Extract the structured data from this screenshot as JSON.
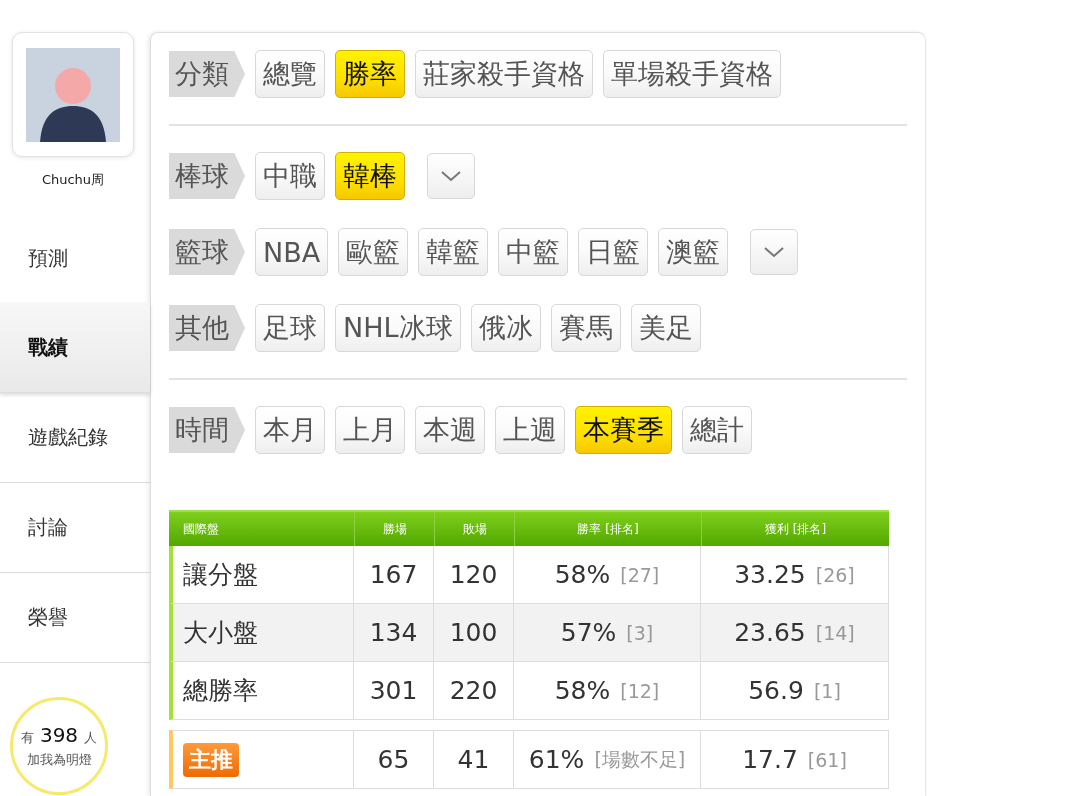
{
  "profile": {
    "name": "Chuchu周"
  },
  "sidebar": {
    "items": [
      {
        "label": "預測",
        "selected": false
      },
      {
        "label": "戰績",
        "selected": true
      },
      {
        "label": "遊戲紀錄",
        "selected": false
      },
      {
        "label": "討論",
        "selected": false
      },
      {
        "label": "榮譽",
        "selected": false
      }
    ]
  },
  "fans": {
    "prefix": "有",
    "count": "398",
    "suffix": "人",
    "caption": "加我為明燈"
  },
  "filter_sections": [
    {
      "rows": [
        {
          "label": "分類",
          "dropdown": false,
          "options": [
            {
              "label": "總覽",
              "selected": false
            },
            {
              "label": "勝率",
              "selected": true
            },
            {
              "label": "莊家殺手資格",
              "selected": false
            },
            {
              "label": "單場殺手資格",
              "selected": false
            }
          ]
        }
      ]
    },
    {
      "rows": [
        {
          "label": "棒球",
          "dropdown": true,
          "options": [
            {
              "label": "中職",
              "selected": false
            },
            {
              "label": "韓棒",
              "selected": true
            }
          ]
        },
        {
          "label": "籃球",
          "dropdown": true,
          "options": [
            {
              "label": "NBA",
              "selected": false
            },
            {
              "label": "歐籃",
              "selected": false
            },
            {
              "label": "韓籃",
              "selected": false
            },
            {
              "label": "中籃",
              "selected": false
            },
            {
              "label": "日籃",
              "selected": false
            },
            {
              "label": "澳籃",
              "selected": false
            }
          ]
        },
        {
          "label": "其他",
          "dropdown": false,
          "options": [
            {
              "label": "足球",
              "selected": false
            },
            {
              "label": "NHL冰球",
              "selected": false
            },
            {
              "label": "俄冰",
              "selected": false
            },
            {
              "label": "賽馬",
              "selected": false
            },
            {
              "label": "美足",
              "selected": false
            }
          ]
        }
      ]
    },
    {
      "rows": [
        {
          "label": "時間",
          "dropdown": false,
          "options": [
            {
              "label": "本月",
              "selected": false
            },
            {
              "label": "上月",
              "selected": false
            },
            {
              "label": "本週",
              "selected": false
            },
            {
              "label": "上週",
              "selected": false
            },
            {
              "label": "本賽季",
              "selected": true
            },
            {
              "label": "總計",
              "selected": false
            }
          ]
        }
      ]
    }
  ],
  "table": {
    "columns": [
      "國際盤",
      "勝場",
      "敗場",
      "勝率 [排名]",
      "獲利 [排名]"
    ],
    "rows": [
      {
        "kind": "normal",
        "name": "讓分盤",
        "wins": "167",
        "losses": "120",
        "rate": "58%",
        "rate_rank": "[27]",
        "profit": "33.25",
        "profit_rank": "[26]"
      },
      {
        "kind": "normal",
        "name": "大小盤",
        "wins": "134",
        "losses": "100",
        "rate": "57%",
        "rate_rank": "[3]",
        "profit": "23.65",
        "profit_rank": "[14]"
      },
      {
        "kind": "normal",
        "name": "總勝率",
        "wins": "301",
        "losses": "220",
        "rate": "58%",
        "rate_rank": "[12]",
        "profit": "56.9",
        "profit_rank": "[1]"
      },
      {
        "kind": "featured",
        "name": "主推",
        "wins": "65",
        "losses": "41",
        "rate": "61%",
        "rate_rank": "[場數不足]",
        "profit": "17.7",
        "profit_rank": "[61]"
      }
    ]
  }
}
